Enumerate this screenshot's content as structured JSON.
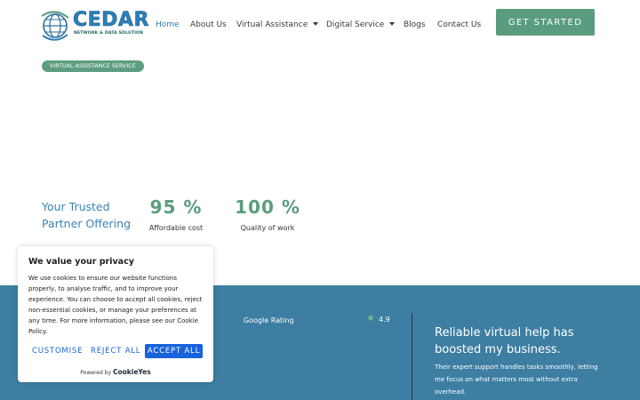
{
  "header": {
    "logo": {
      "word": "CEDAR",
      "tagline": "NETWORK & DATA SOLUTION"
    },
    "nav": [
      {
        "label": "Home",
        "active": true
      },
      {
        "label": "About Us"
      },
      {
        "label": "Virtual Assistance",
        "dropdown": true
      },
      {
        "label": "Digital Service",
        "dropdown": true
      },
      {
        "label": "Blogs"
      },
      {
        "label": "Contact Us"
      }
    ],
    "cta_label": "GET STARTED"
  },
  "hero": {
    "badge": "VIRTUAL ASSISTANCE SERVICE",
    "trusted": "Your Trusted Partner Offering",
    "stats": [
      {
        "value": "95 %",
        "label": "Affordable cost"
      },
      {
        "value": "100 %",
        "label": "Quality of work"
      }
    ]
  },
  "band": {
    "google_rating_label": "Google Rating",
    "rating_value": "4.9",
    "testimonial_title": "Reliable virtual help has boosted my business.",
    "testimonial_body": "Their expert support handles tasks smoothly, letting me focus on what matters most without extra overhead."
  },
  "cookie": {
    "title": "We value your privacy",
    "text": "We use cookies to ensure our website functions properly, to analyse traffic, and to improve your experience. You can choose to accept all cookies, reject non-essential cookies, or manage your preferences at any time. For more information, please see our Cookie Policy.",
    "customise": "CUSTOMISE",
    "reject": "REJECT ALL",
    "accept": "ACCEPT ALL",
    "powered_by": "Powered by",
    "brand": "CookieYes"
  },
  "colors": {
    "accent_green": "#5a9c7e",
    "accent_blue": "#3d7ea2",
    "cookie_blue": "#1863dc"
  }
}
